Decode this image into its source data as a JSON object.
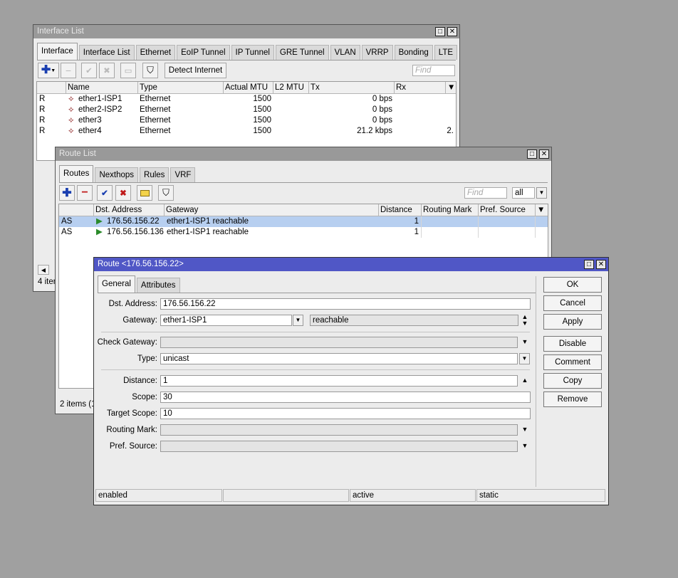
{
  "interface_list": {
    "title": "Interface List",
    "tabs": [
      "Interface",
      "Interface List",
      "Ethernet",
      "EoIP Tunnel",
      "IP Tunnel",
      "GRE Tunnel",
      "VLAN",
      "VRRP",
      "Bonding",
      "LTE"
    ],
    "detect_label": "Detect Internet",
    "find_placeholder": "Find",
    "columns": {
      "name": "Name",
      "type": "Type",
      "mtu": "Actual MTU",
      "l2mtu": "L2 MTU",
      "tx": "Tx",
      "rx": "Rx"
    },
    "rows": [
      {
        "flag": "R",
        "name": "ether1-ISP1",
        "type": "Ethernet",
        "mtu": "1500",
        "l2mtu": "",
        "tx": "0 bps",
        "rx": ""
      },
      {
        "flag": "R",
        "name": "ether2-ISP2",
        "type": "Ethernet",
        "mtu": "1500",
        "l2mtu": "",
        "tx": "0 bps",
        "rx": ""
      },
      {
        "flag": "R",
        "name": "ether3",
        "type": "Ethernet",
        "mtu": "1500",
        "l2mtu": "",
        "tx": "0 bps",
        "rx": ""
      },
      {
        "flag": "R",
        "name": "ether4",
        "type": "Ethernet",
        "mtu": "1500",
        "l2mtu": "",
        "tx": "21.2 kbps",
        "rx": "2."
      }
    ],
    "status_count": "4 iter"
  },
  "route_list": {
    "title": "Route List",
    "tabs": [
      "Routes",
      "Nexthops",
      "Rules",
      "VRF"
    ],
    "find_placeholder": "Find",
    "filter_value": "all",
    "columns": {
      "dst": "Dst. Address",
      "gateway": "Gateway",
      "distance": "Distance",
      "mark": "Routing Mark",
      "pref": "Pref. Source"
    },
    "rows": [
      {
        "flag": "AS",
        "dst": "176.56.156.22",
        "gateway": "ether1-ISP1 reachable",
        "distance": "1",
        "mark": "",
        "pref": "",
        "selected": true
      },
      {
        "flag": "AS",
        "dst": "176.56.156.136",
        "gateway": "ether1-ISP1 reachable",
        "distance": "1",
        "mark": "",
        "pref": "",
        "selected": false
      }
    ],
    "status_count": "2 items (1"
  },
  "route_dialog": {
    "title": "Route <176.56.156.22>",
    "tabs": [
      "General",
      "Attributes"
    ],
    "labels": {
      "dst": "Dst. Address:",
      "gateway": "Gateway:",
      "check_gateway": "Check Gateway:",
      "type": "Type:",
      "distance": "Distance:",
      "scope": "Scope:",
      "target_scope": "Target Scope:",
      "routing_mark": "Routing Mark:",
      "pref_source": "Pref. Source:"
    },
    "values": {
      "dst": "176.56.156.22",
      "gateway": "ether1-ISP1",
      "gateway_state": "reachable",
      "check_gateway": "",
      "type": "unicast",
      "distance": "1",
      "scope": "30",
      "target_scope": "10",
      "routing_mark": "",
      "pref_source": ""
    },
    "buttons": {
      "ok": "OK",
      "cancel": "Cancel",
      "apply": "Apply",
      "disable": "Disable",
      "comment": "Comment",
      "copy": "Copy",
      "remove": "Remove"
    },
    "status": [
      "enabled",
      "",
      "active",
      "static"
    ]
  },
  "colors": {
    "active_title": "#5057c6",
    "selected_row": "#b7cff0",
    "inactive_title": "#999999",
    "add": "#1a3fb0",
    "remove": "#c01a1a",
    "enable": "#1a3fb0"
  },
  "icons": {
    "add": "plus-icon",
    "remove": "minus-icon",
    "enable": "check-icon",
    "disable": "x-icon",
    "comment": "note-icon",
    "filter": "funnel-icon",
    "dropdown": "triangle-down-icon",
    "interface": "ethernet-port-icon",
    "route": "route-arrow-icon"
  }
}
